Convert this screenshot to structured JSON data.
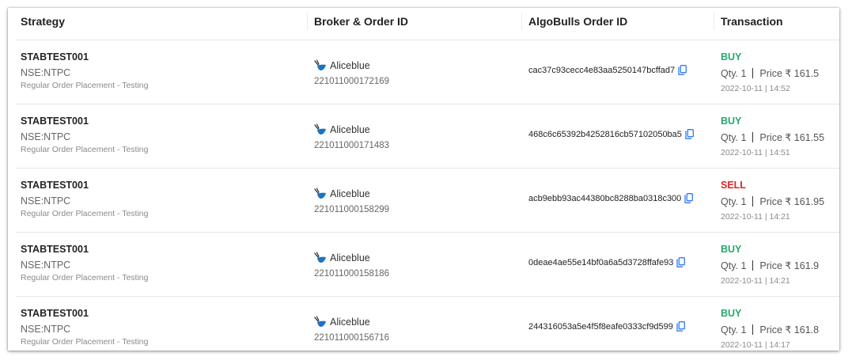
{
  "columns": {
    "strategy": "Strategy",
    "broker": "Broker & Order ID",
    "algobulls": "AlgoBulls Order ID",
    "transaction": "Transaction"
  },
  "colors": {
    "buy": "#27a86b",
    "sell": "#e02424",
    "copy_icon": "#2f7bf5",
    "broker_icon": "#1a73c8"
  },
  "rows": [
    {
      "strategy_name": "STABTEST001",
      "instrument": "NSE:NTPC",
      "description": "Regular Order Placement - Testing",
      "broker_name": "Aliceblue",
      "broker_order_id": "221011000172169",
      "algobulls_order_id": "cac37c93cecc4e83aa5250147bcffad7",
      "type": "BUY",
      "qty": "Qty. 1",
      "price": "Price ₹ 161.5",
      "time": "2022-10-11 | 14:52"
    },
    {
      "strategy_name": "STABTEST001",
      "instrument": "NSE:NTPC",
      "description": "Regular Order Placement - Testing",
      "broker_name": "Aliceblue",
      "broker_order_id": "221011000171483",
      "algobulls_order_id": "468c6c65392b4252816cb57102050ba5",
      "type": "BUY",
      "qty": "Qty. 1",
      "price": "Price ₹ 161.55",
      "time": "2022-10-11 | 14:51"
    },
    {
      "strategy_name": "STABTEST001",
      "instrument": "NSE:NTPC",
      "description": "Regular Order Placement - Testing",
      "broker_name": "Aliceblue",
      "broker_order_id": "221011000158299",
      "algobulls_order_id": "acb9ebb93ac44380bc8288ba0318c300",
      "type": "SELL",
      "qty": "Qty. 1",
      "price": "Price ₹ 161.95",
      "time": "2022-10-11 | 14:21"
    },
    {
      "strategy_name": "STABTEST001",
      "instrument": "NSE:NTPC",
      "description": "Regular Order Placement - Testing",
      "broker_name": "Aliceblue",
      "broker_order_id": "221011000158186",
      "algobulls_order_id": "0deae4ae55e14bf0a6a5d3728ffafe93",
      "type": "BUY",
      "qty": "Qty. 1",
      "price": "Price ₹ 161.9",
      "time": "2022-10-11 | 14:21"
    },
    {
      "strategy_name": "STABTEST001",
      "instrument": "NSE:NTPC",
      "description": "Regular Order Placement - Testing",
      "broker_name": "Aliceblue",
      "broker_order_id": "221011000156716",
      "algobulls_order_id": "244316053a5e4f5f8eafe0333cf9d599",
      "type": "BUY",
      "qty": "Qty. 1",
      "price": "Price ₹ 161.8",
      "time": "2022-10-11 | 14:17"
    }
  ]
}
